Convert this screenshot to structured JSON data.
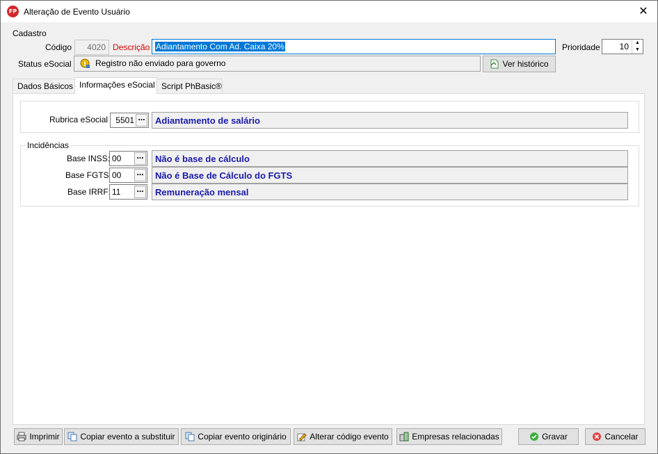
{
  "window": {
    "title": "Alteração de Evento Usuário",
    "app_icon_text": "FP",
    "close_glyph": "✕"
  },
  "cadastro": {
    "legend": "Cadastro",
    "codigo_label": "Código",
    "codigo_value": "4020",
    "descricao_label": "Descrição",
    "descricao_value": "Adiantamento Com Ad. Caixa 20%",
    "prioridade_label": "Prioridade",
    "prioridade_value": "10",
    "status_label": "Status eSocial",
    "status_value": "Registro não enviado para governo",
    "historico_button": "Ver histórico"
  },
  "tabs": [
    {
      "label": "Dados Básicos"
    },
    {
      "label": "Informações eSocial"
    },
    {
      "label": "Script PhBasic®"
    }
  ],
  "esocial": {
    "rubrica_label": "Rubrica eSocial",
    "rubrica_code": "5501",
    "rubrica_desc": "Adiantamento de salário",
    "incidencias_legend": "Incidências",
    "rows": [
      {
        "label": "Base INSS:",
        "code": "00",
        "desc": "Não é base de cálculo"
      },
      {
        "label": "Base FGTS:",
        "code": "00",
        "desc": "Não é Base de Cálculo do FGTS"
      },
      {
        "label": "Base IRRF:",
        "code": "11",
        "desc": "Remuneração mensal"
      }
    ]
  },
  "footer": {
    "imprimir": "Imprimir",
    "copiar_substituir": "Copiar evento a substituir",
    "copiar_originario": "Copiar evento originário",
    "alterar_codigo": "Alterar código evento",
    "empresas": "Empresas relacionadas",
    "gravar": "Gravar",
    "cancelar": "Cancelar"
  },
  "colors": {
    "selection": "#0078d7",
    "desc_text": "#1a1aaf",
    "descricao_label": "#d40000"
  }
}
